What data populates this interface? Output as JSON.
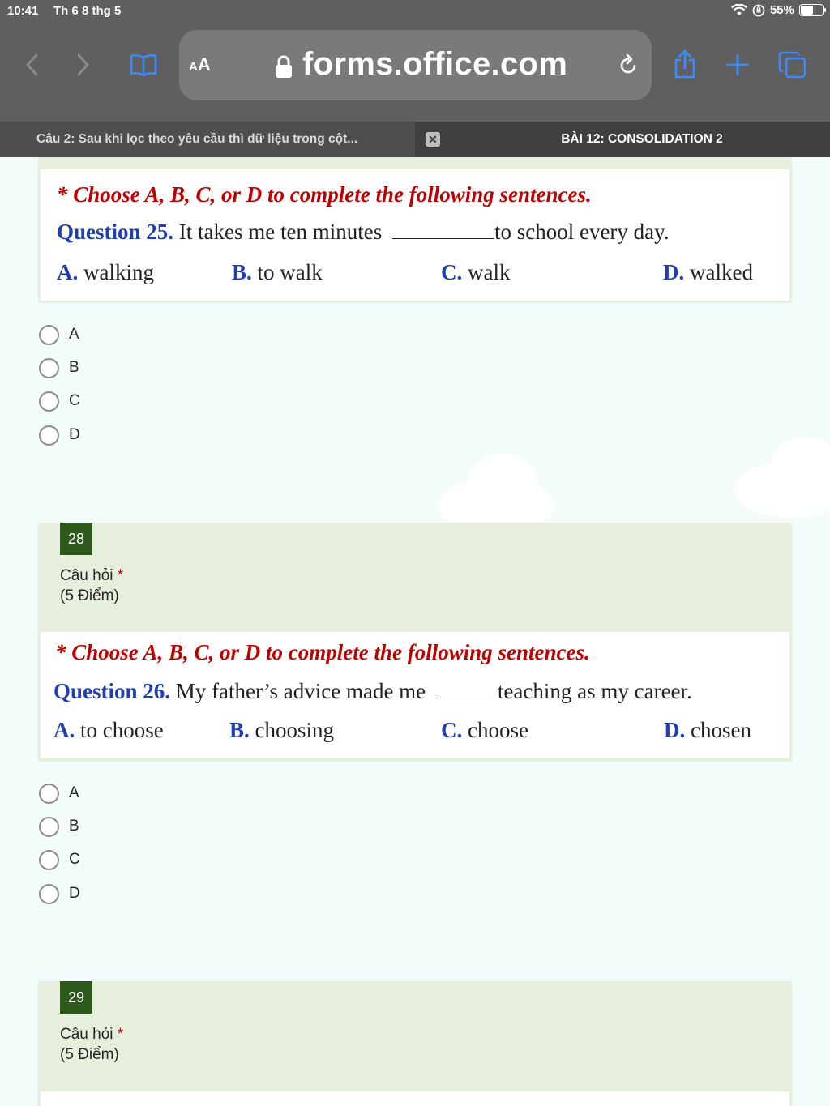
{
  "status_bar": {
    "time": "10:41",
    "date": "Th 6 8 thg 5",
    "battery": "55%"
  },
  "toolbar": {
    "text_size_label_small": "A",
    "text_size_label_large": "A",
    "url": "forms.office.com",
    "icons": [
      "chevron-left-icon",
      "chevron-right-icon",
      "book-icon",
      "lock-icon",
      "reload-icon",
      "share-icon",
      "plus-icon",
      "tabs-icon"
    ]
  },
  "tabs": [
    {
      "label": "Câu 2: Sau khi lọc theo yêu cầu thì dữ liệu trong cột...",
      "active": true
    },
    {
      "label": "BÀI 12: CONSOLIDATION 2",
      "active": false
    }
  ],
  "tab_close_glyph": "✕",
  "questions": [
    {
      "instruction": "* Choose A, B, C, or D to complete the following sentences.",
      "label": "Question 25.",
      "text_before": "It takes me ten minutes",
      "text_after": "to school every day.",
      "options": [
        {
          "letter": "A.",
          "text": "walking"
        },
        {
          "letter": "B.",
          "text": "to walk"
        },
        {
          "letter": "C.",
          "text": "walk"
        },
        {
          "letter": "D.",
          "text": "walked"
        }
      ],
      "choices": [
        "A",
        "B",
        "C",
        "D"
      ]
    },
    {
      "number": "28",
      "title": "Câu hỏi",
      "required_mark": "*",
      "points": "(5 Điểm)",
      "instruction": "* Choose A, B, C, or D to complete the following sentences.",
      "label": "Question 26.",
      "text_before": "My father’s advice made me",
      "text_after": "teaching as my career.",
      "options": [
        {
          "letter": "A.",
          "text": "to choose"
        },
        {
          "letter": "B.",
          "text": "choosing"
        },
        {
          "letter": "C.",
          "text": "choose"
        },
        {
          "letter": "D.",
          "text": "chosen"
        }
      ],
      "choices": [
        "A",
        "B",
        "C",
        "D"
      ]
    },
    {
      "number": "29",
      "title": "Câu hỏi",
      "required_mark": "*",
      "points": "(5 Điểm)"
    }
  ],
  "colors": {
    "chrome": "#5f5f5f",
    "accent_blue": "#3a8bff",
    "card_green": "#e6efdc",
    "question_number_bg": "#2d5a1b",
    "instruction_red": "#c00000",
    "label_blue": "#1f3fb0"
  }
}
